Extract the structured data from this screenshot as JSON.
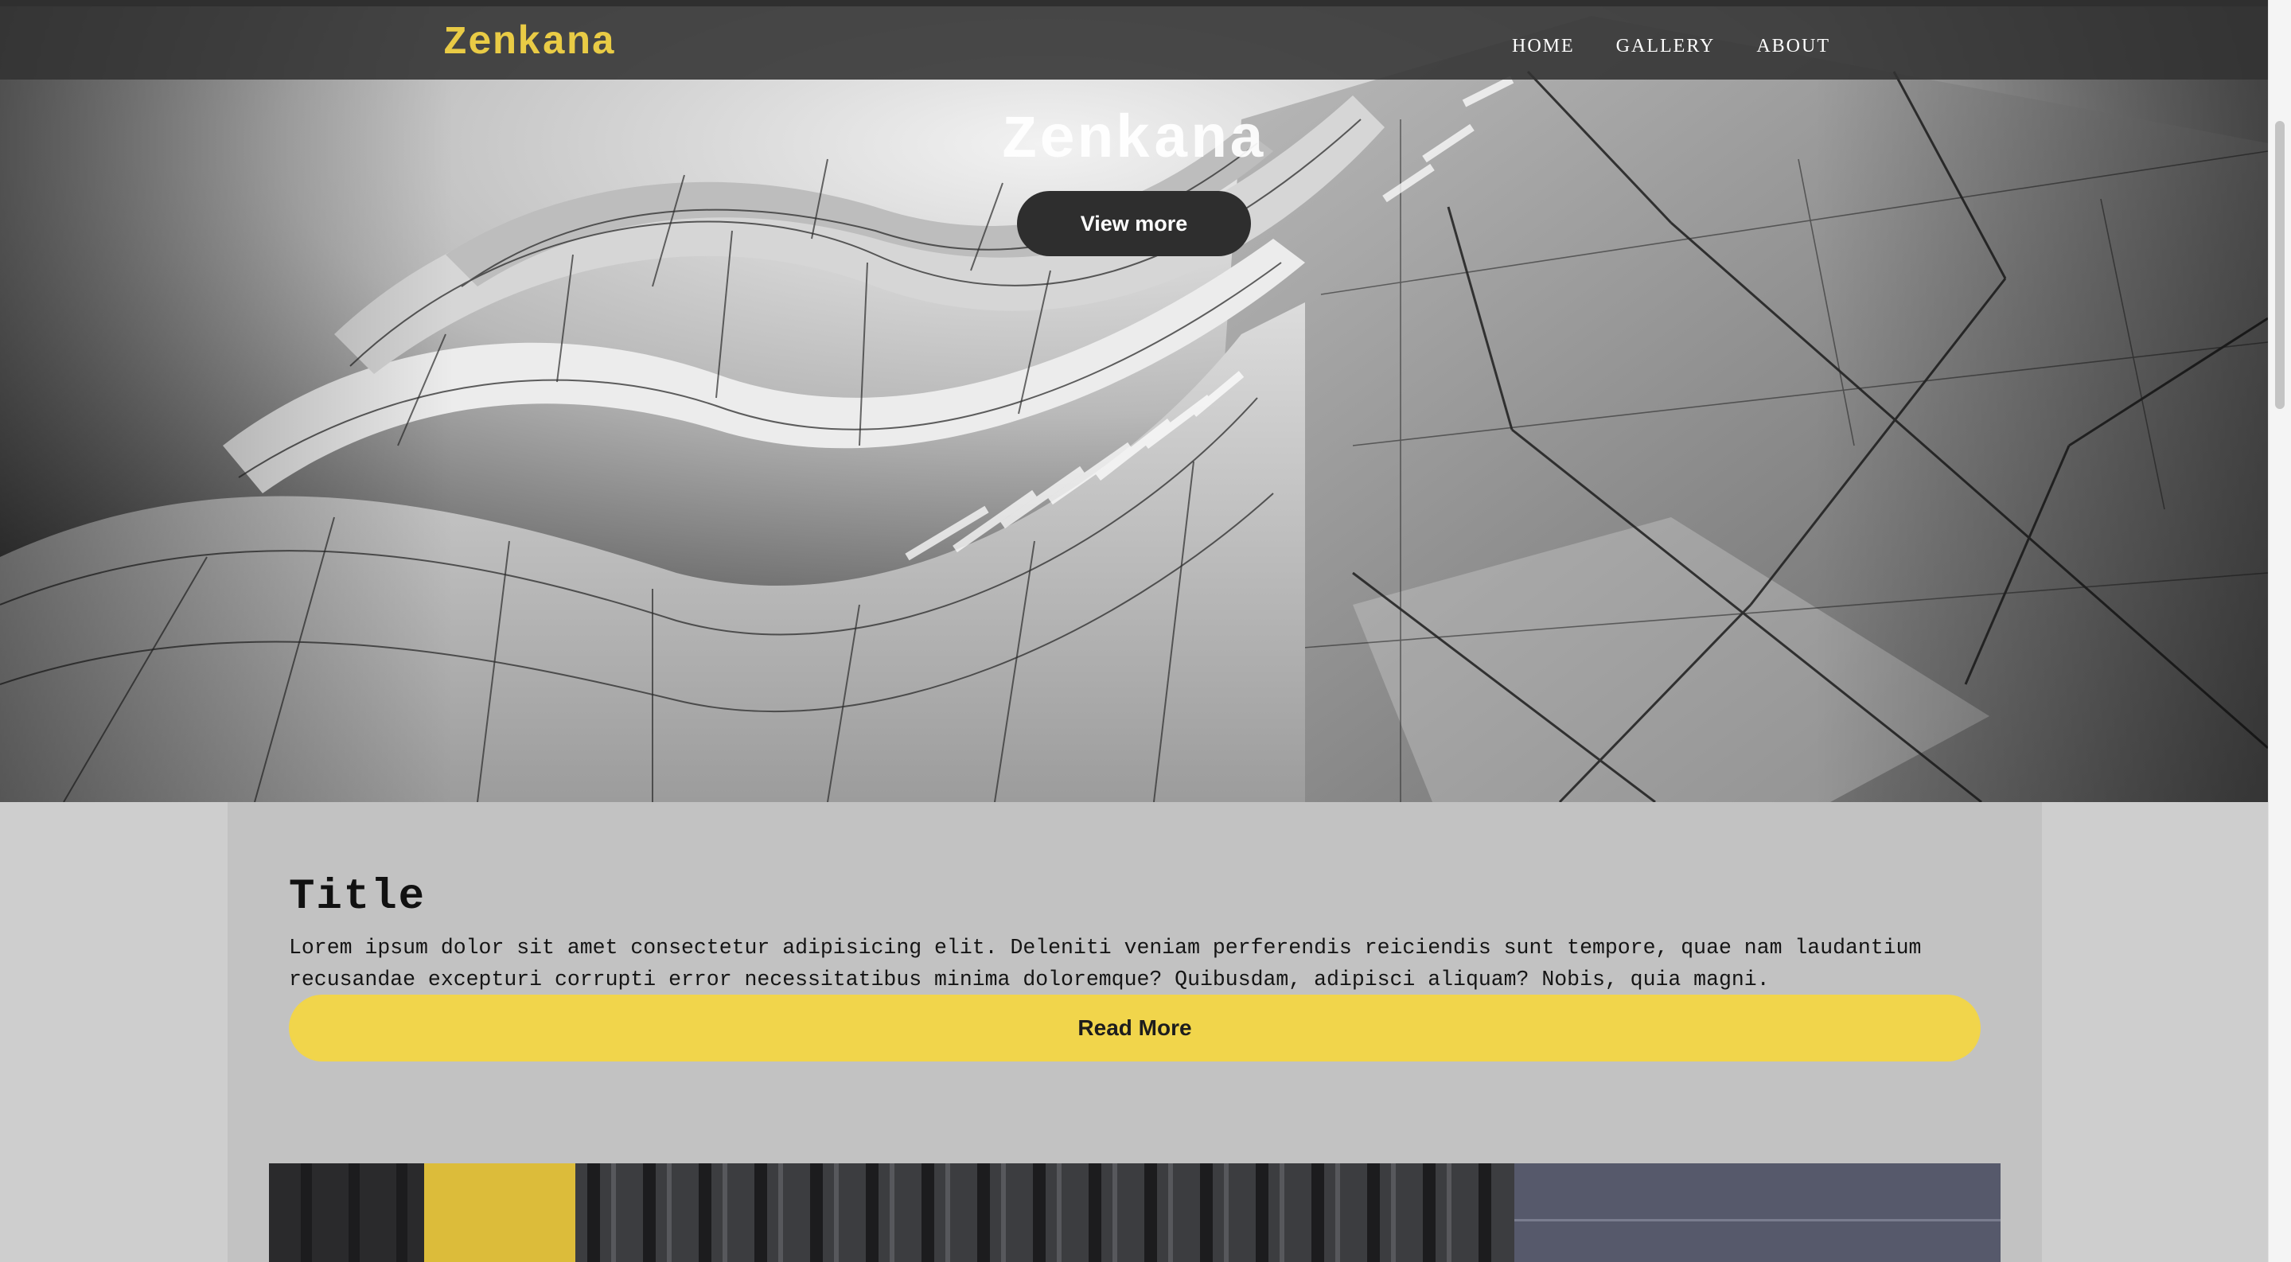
{
  "brand": {
    "name": "Zenkana",
    "color": "#e9cb45"
  },
  "nav": {
    "items": [
      {
        "label": "HOME"
      },
      {
        "label": "GALLERY"
      },
      {
        "label": "ABOUT"
      }
    ]
  },
  "hero": {
    "title": "Zenkana",
    "button_label": "View more",
    "image_icon": "architecture-photo"
  },
  "card": {
    "title": "Title",
    "text": "Lorem ipsum dolor sit amet consectetur adipisicing elit. Deleniti veniam perferendis reiciendis sunt tempore, quae nam laudantium recusandae excepturi corrupti error necessitatibus minima doloremque? Quibusdam, adipisci aliquam? Nobis, quia magni.",
    "button_label": "Read More",
    "button_color": "#f1d54b",
    "image_icon": "corrugated-wall-photo"
  }
}
